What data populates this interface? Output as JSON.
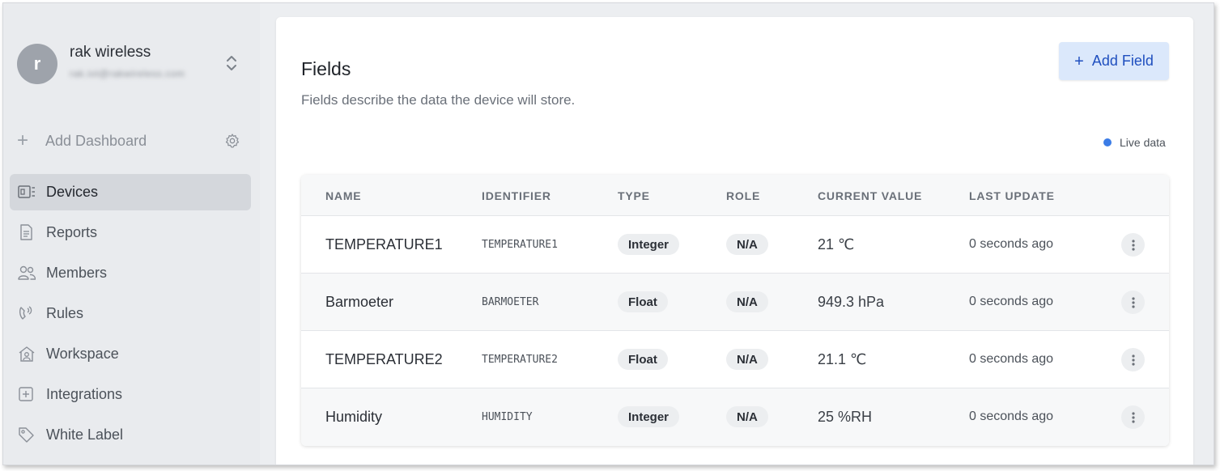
{
  "account": {
    "initial": "r",
    "name": "rak wireless",
    "email": "rak.iot@rakwireless.com"
  },
  "sidebar": {
    "add_dashboard": "Add Dashboard",
    "items": [
      {
        "label": "Devices",
        "icon": "devices-icon",
        "active": true
      },
      {
        "label": "Reports",
        "icon": "report-icon",
        "active": false
      },
      {
        "label": "Members",
        "icon": "members-icon",
        "active": false
      },
      {
        "label": "Rules",
        "icon": "rules-icon",
        "active": false
      },
      {
        "label": "Workspace",
        "icon": "workspace-icon",
        "active": false
      },
      {
        "label": "Integrations",
        "icon": "integrations-icon",
        "active": false
      },
      {
        "label": "White Label",
        "icon": "tag-icon",
        "active": false
      }
    ]
  },
  "main": {
    "title": "Fields",
    "subtitle": "Fields describe the data the device will store.",
    "add_field_label": "Add Field",
    "live_label": "Live data",
    "table": {
      "headers": [
        "NAME",
        "IDENTIFIER",
        "TYPE",
        "ROLE",
        "CURRENT VALUE",
        "LAST UPDATE"
      ],
      "rows": [
        {
          "name": "TEMPERATURE1",
          "identifier": "TEMPERATURE1",
          "type": "Integer",
          "role": "N/A",
          "value": "21 ℃",
          "updated": "0 seconds ago"
        },
        {
          "name": "Barmoeter",
          "identifier": "BARMOETER",
          "type": "Float",
          "role": "N/A",
          "value": "949.3 hPa",
          "updated": "0 seconds ago"
        },
        {
          "name": "TEMPERATURE2",
          "identifier": "TEMPERATURE2",
          "type": "Float",
          "role": "N/A",
          "value": "21.1 ℃",
          "updated": "0 seconds ago"
        },
        {
          "name": "Humidity",
          "identifier": "HUMIDITY",
          "type": "Integer",
          "role": "N/A",
          "value": "25 %RH",
          "updated": "0 seconds ago"
        }
      ]
    }
  },
  "colors": {
    "accent": "#1f4fbf",
    "accent_bg": "#dbe8fb",
    "live_dot": "#3b7ce6",
    "sidebar_bg": "#e9ebee"
  }
}
